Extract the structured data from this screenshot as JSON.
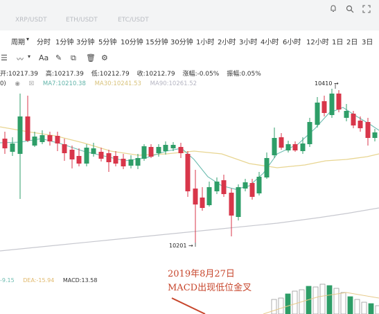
{
  "header": {
    "pairs": [
      {
        "symbol": "XRP/USDT",
        "sub": "--"
      },
      {
        "symbol": "ETH/USDT",
        "sub": "--"
      },
      {
        "symbol": "ETC/USDT",
        "sub": "--"
      }
    ],
    "icons": [
      "bell-icon",
      "search-icon",
      "expand-icon"
    ]
  },
  "intervals": {
    "label": "周期",
    "items": [
      "分时",
      "1分钟",
      "3分钟",
      "5分钟",
      "10分钟",
      "15分钟",
      "30分钟",
      "1小时",
      "2小时",
      "3小时",
      "4小时",
      "6小时",
      "12小时",
      "1日",
      "2日",
      "3日"
    ]
  },
  "toolbar": {
    "icons": [
      "menu-icon",
      "wave-icon",
      "font-icon",
      "pen-icon",
      "copy-icon",
      "delete-icon",
      "settings-icon"
    ],
    "font_label": "Aa"
  },
  "ohlc": {
    "open_label": "开:10217.39",
    "high_label": "高:10217.39",
    "low_label": "低:10212.79",
    "close_label": "收:10212.79",
    "change_label": "涨幅:-0.05%",
    "amplitude_label": "振幅:0.05%"
  },
  "ma": {
    "prefix": "0)",
    "ma7": "MA7:10210.38",
    "ma30": "MA30:10241.53",
    "ma90": "MA90:10261.52"
  },
  "macd": {
    "dif": "-9.15",
    "dea": "DEA:-15.94",
    "macd": "MACD:13.58"
  },
  "annotation": {
    "line1": "2019年8月27日",
    "line2": "MACD出现低位金叉"
  },
  "price_labels": {
    "high": "10410",
    "low": "10201"
  },
  "colors": {
    "up": "#2e9e68",
    "down": "#d8364a",
    "ma7": "#6dbcb0",
    "ma30": "#e8d591",
    "ma90": "#c7c8cf"
  },
  "chart_data": {
    "type": "candlestick",
    "marked_high": 10410,
    "marked_low": 10201,
    "series": []
  }
}
